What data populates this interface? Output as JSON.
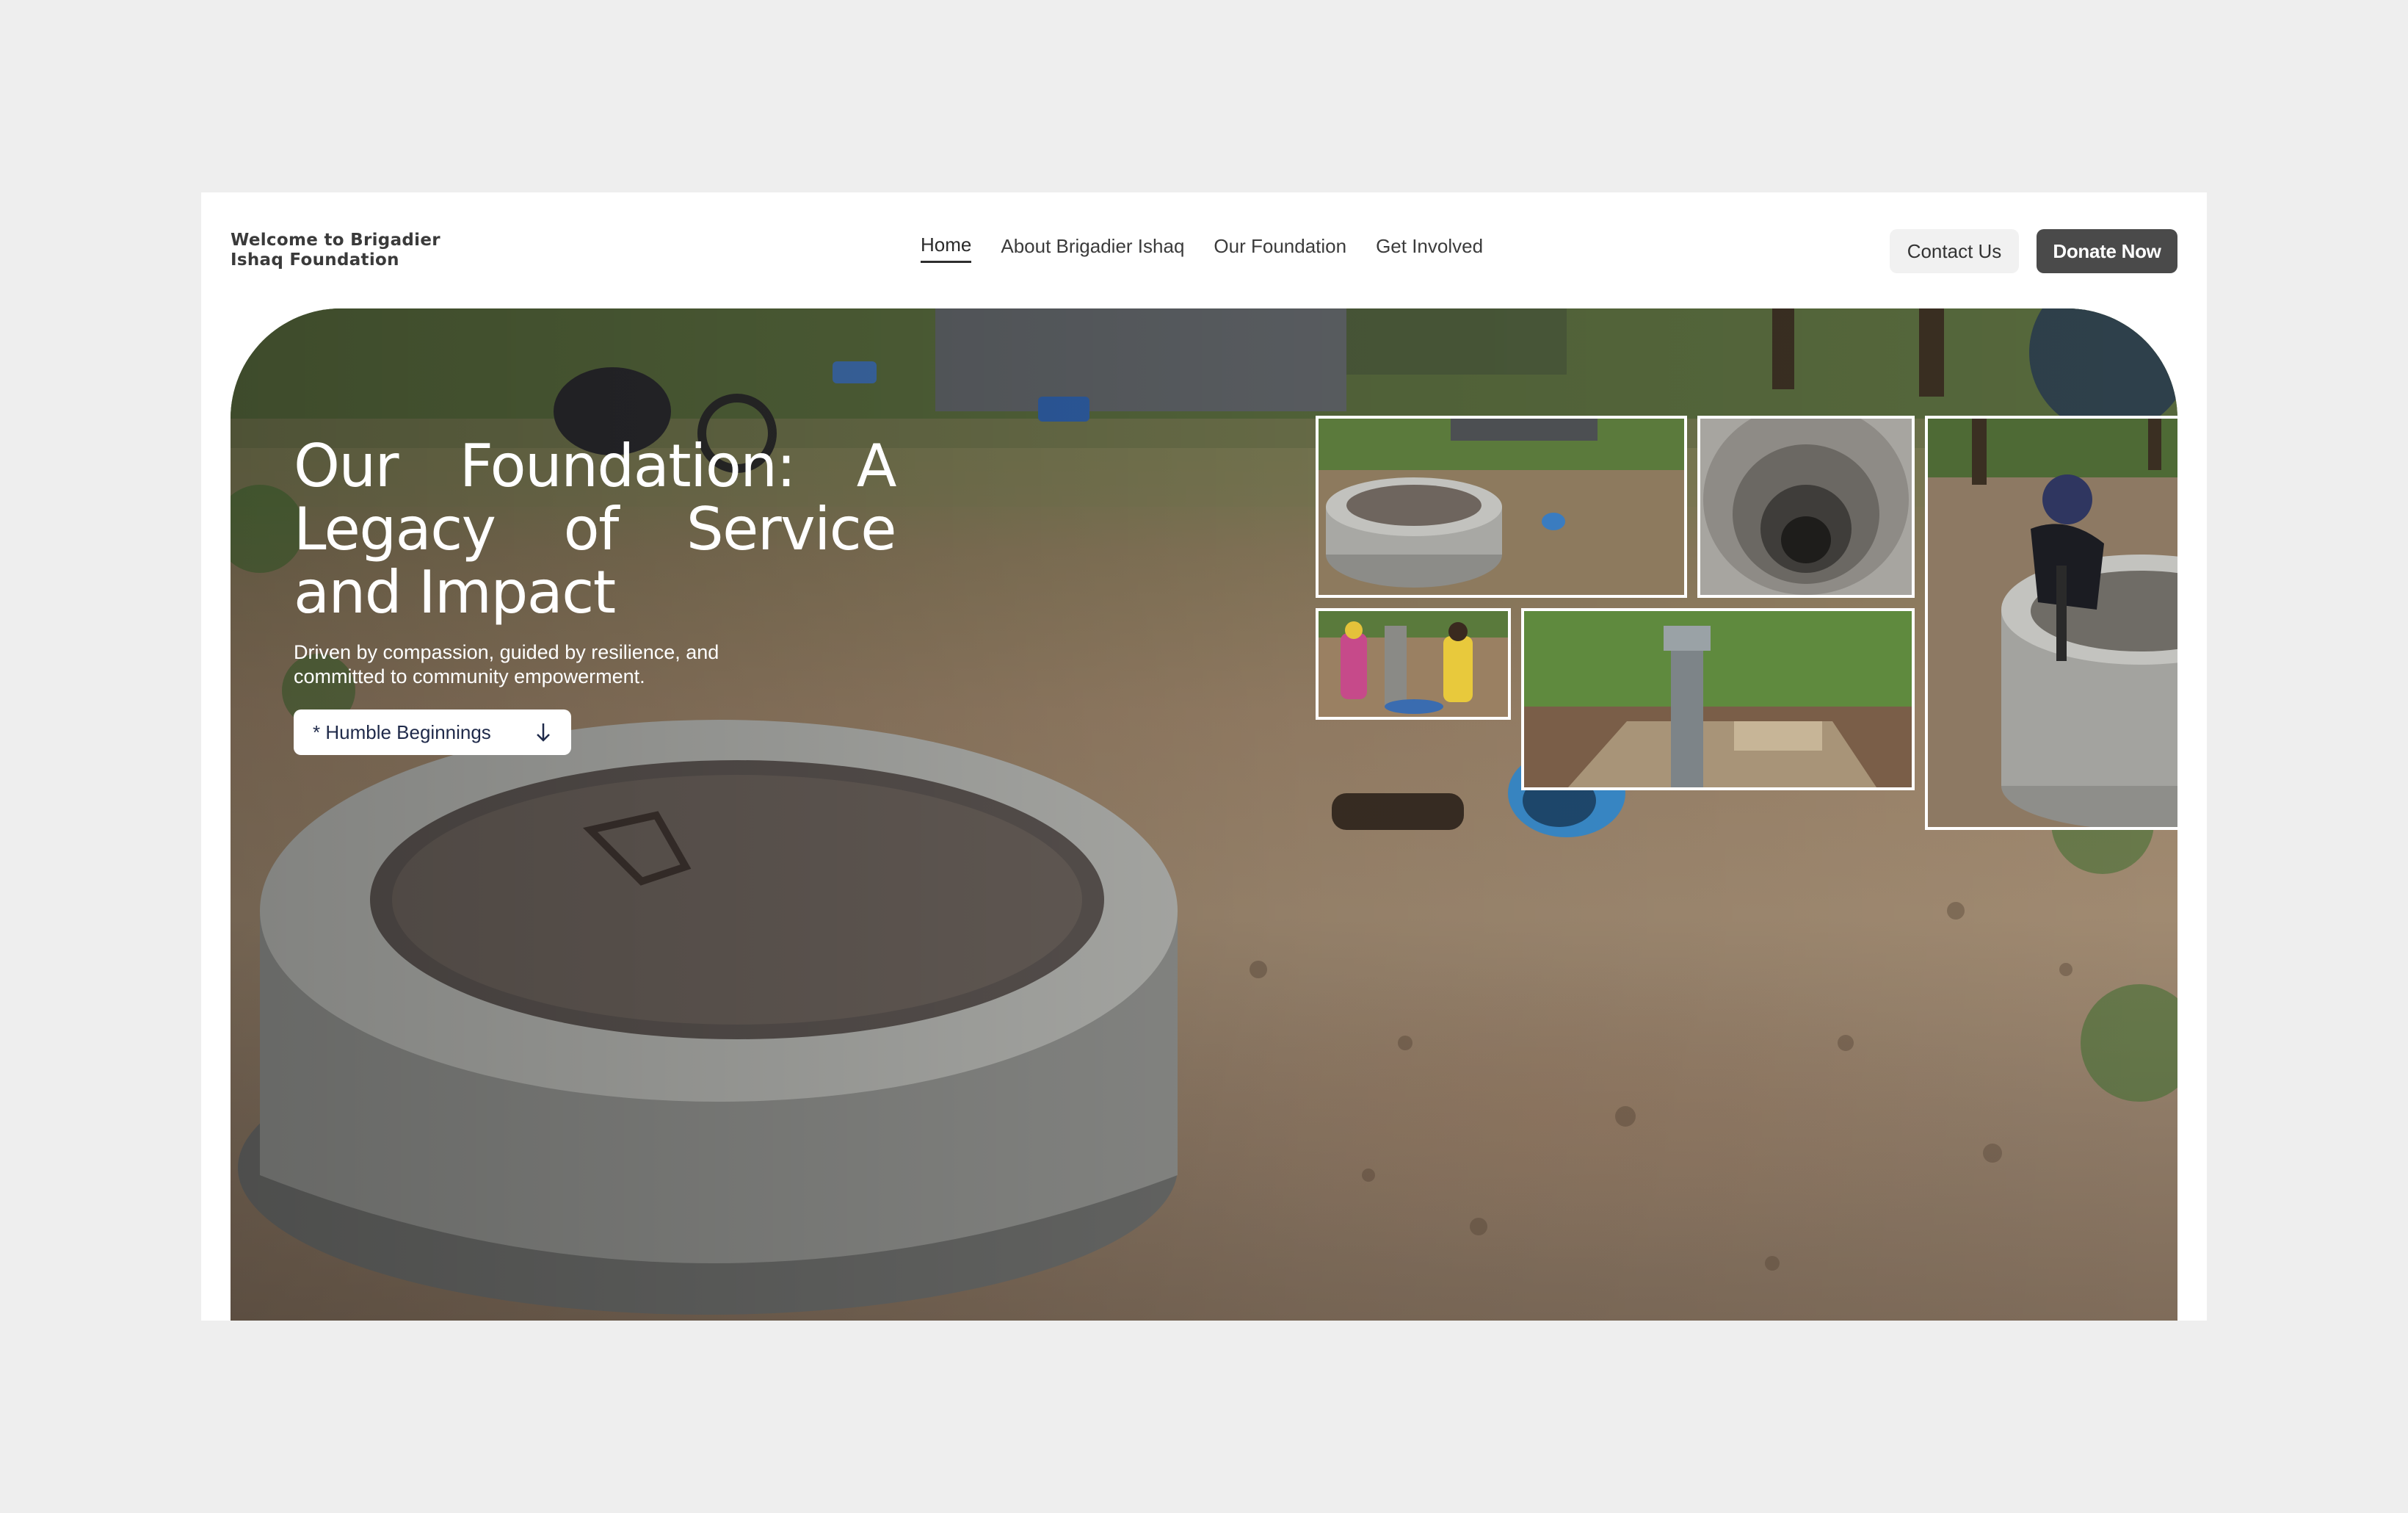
{
  "brand": {
    "line1": "Welcome to Brigadier",
    "line2": "Ishaq Foundation"
  },
  "nav": {
    "items": [
      {
        "label": "Home",
        "active": true
      },
      {
        "label": "About Brigadier Ishaq",
        "active": false
      },
      {
        "label": "Our Foundation",
        "active": false
      },
      {
        "label": "Get Involved",
        "active": false
      }
    ]
  },
  "actions": {
    "contact_label": "Contact Us",
    "donate_label": "Donate Now"
  },
  "hero": {
    "title": "Our Foundation: A Legacy of Service and Impact",
    "subtitle_line1": "Driven by compassion, guided by resilience, and",
    "subtitle_line2": "committed to community empowerment.",
    "cta_label": "* Humble Beginnings",
    "cta_icon": "arrow-down-icon"
  },
  "gallery": {
    "photos": [
      {
        "subject": "covered-well-photo"
      },
      {
        "subject": "well-interior-photo"
      },
      {
        "subject": "woman-at-well-photo"
      },
      {
        "subject": "women-at-pump-photo"
      },
      {
        "subject": "hand-pump-photo"
      }
    ]
  },
  "colors": {
    "page_bg": "#eeeeee",
    "card_bg": "#ffffff",
    "donate_bg": "#4a4a4a",
    "contact_bg": "#f1f1f1",
    "cta_text": "#1f2a4a"
  }
}
